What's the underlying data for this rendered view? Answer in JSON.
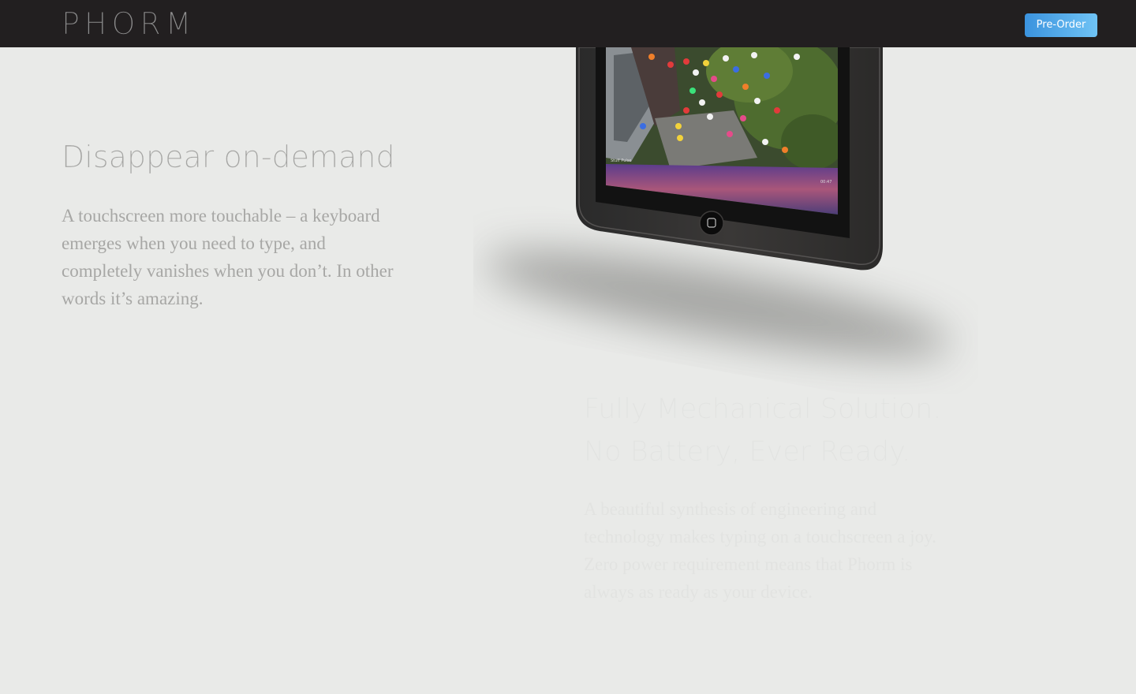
{
  "header": {
    "logo": "PHORM",
    "preorder_label": "Pre-Order"
  },
  "sections": [
    {
      "title": "Disappear on-demand",
      "body": "A touchscreen more touchable –  a keyboard emerges when you need to type, and completely vanishes when you don’t. In other words it’s amazing."
    },
    {
      "title_line1": "Fully Mechanical Solution.",
      "title_line2": "No Battery, Ever Ready.",
      "body": "A beautiful synthesis of engineering and technology makes typing on a touchscreen a joy. Zero power requirement means that Phorm is always as ready as your device."
    }
  ],
  "device_screen": {
    "status_left": "Stuff Pulse",
    "status_time": "00:47"
  },
  "icons": {
    "home": "home-button-icon"
  },
  "colors": {
    "background": "#e9eae8",
    "topbar": "#221f20",
    "button_start": "#3b93de",
    "button_end": "#6fc3f5"
  }
}
